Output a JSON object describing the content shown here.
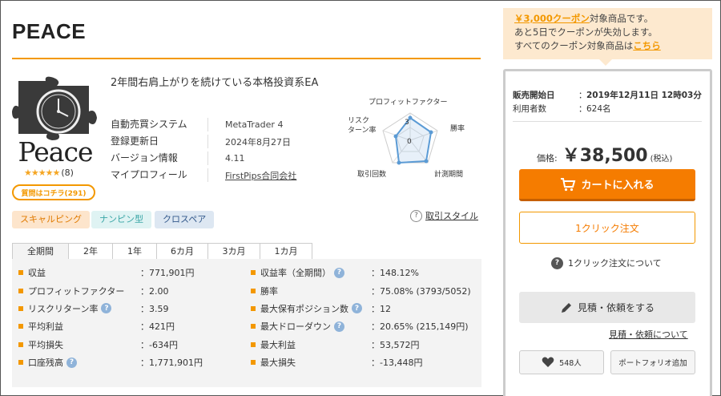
{
  "product": {
    "title": "PEACE",
    "logo_text": "Peace",
    "stars": "★★★★★",
    "review_count": "(8)",
    "reviews_button": "質問はコチラ(291)",
    "description": "2年間右肩上がりを続けている本格投資系EA",
    "info": [
      {
        "label": "自動売買システム",
        "value": "MetaTrader 4"
      },
      {
        "label": "登録更新日",
        "value": "2024年8月27日"
      },
      {
        "label": "バージョン情報",
        "value": "4.11"
      },
      {
        "label": "マイプロフィール",
        "value": "FirstPips合同会社"
      }
    ]
  },
  "radar": {
    "title": "プロフィットファクター",
    "labels": {
      "left": "リスク\nターン率",
      "right": "勝率",
      "bottom_left": "取引回数",
      "bottom_right": "計測期間"
    },
    "scale_max": "3",
    "scale_min": "0",
    "color": "#5b9bd5"
  },
  "tags": [
    "スキャルピング",
    "ナンピン型",
    "クロスペア"
  ],
  "trade_style_link": "取引スタイル",
  "tabs": [
    "全期間",
    "2年",
    "1年",
    "6カ月",
    "3カ月",
    "1カ月"
  ],
  "stats_left": [
    {
      "label": "収益",
      "value": "：771,901円",
      "help": false
    },
    {
      "label": "プロフィットファクター",
      "value": "：2.00",
      "help": false
    },
    {
      "label": "リスクリターン率",
      "value": "：3.59",
      "help": true
    },
    {
      "label": "平均利益",
      "value": "：421円",
      "help": false
    },
    {
      "label": "平均損失",
      "value": "：-634円",
      "help": false
    },
    {
      "label": "口座残高",
      "value": "：1,771,901円",
      "help": true
    }
  ],
  "stats_right": [
    {
      "label": "収益率（全期間）",
      "value": "：148.12%",
      "help": true
    },
    {
      "label": "勝率",
      "value": "：75.08% (3793/5052)",
      "help": false
    },
    {
      "label": "最大保有ポジション数",
      "value": "：12",
      "help": true
    },
    {
      "label": "最大ドローダウン",
      "value": "：20.65% (215,149円)",
      "help": true
    },
    {
      "label": "最大利益",
      "value": "：53,572円",
      "help": false
    },
    {
      "label": "最大損失",
      "value": "：-13,448円",
      "help": false
    }
  ],
  "coupon": {
    "amount": "￥3,000クーポン",
    "line1_suffix": "対象商品です。",
    "line2": "あと5日でクーポンが失効します。",
    "line3_prefix": "すべてのクーポン対象商品は",
    "line3_link": "こちら"
  },
  "sale": {
    "start_label": "販売開始日",
    "start_value": "2019年12月11日 12時03分",
    "users_label": "利用者数",
    "users_value": "624名",
    "colon": "："
  },
  "price": {
    "label": "価格:",
    "value": "￥38,500",
    "tax": "(税込)"
  },
  "buttons": {
    "cart": "カートに入れる",
    "one_click": "1クリック注文",
    "one_click_about": "1クリック注文について",
    "quote": "見積・依頼をする",
    "quote_about": "見積・依頼について",
    "like_count": "548人",
    "portfolio": "ポートフォリオ追加"
  },
  "colors": {
    "accent": "#f39800",
    "cart": "#f57c00"
  }
}
